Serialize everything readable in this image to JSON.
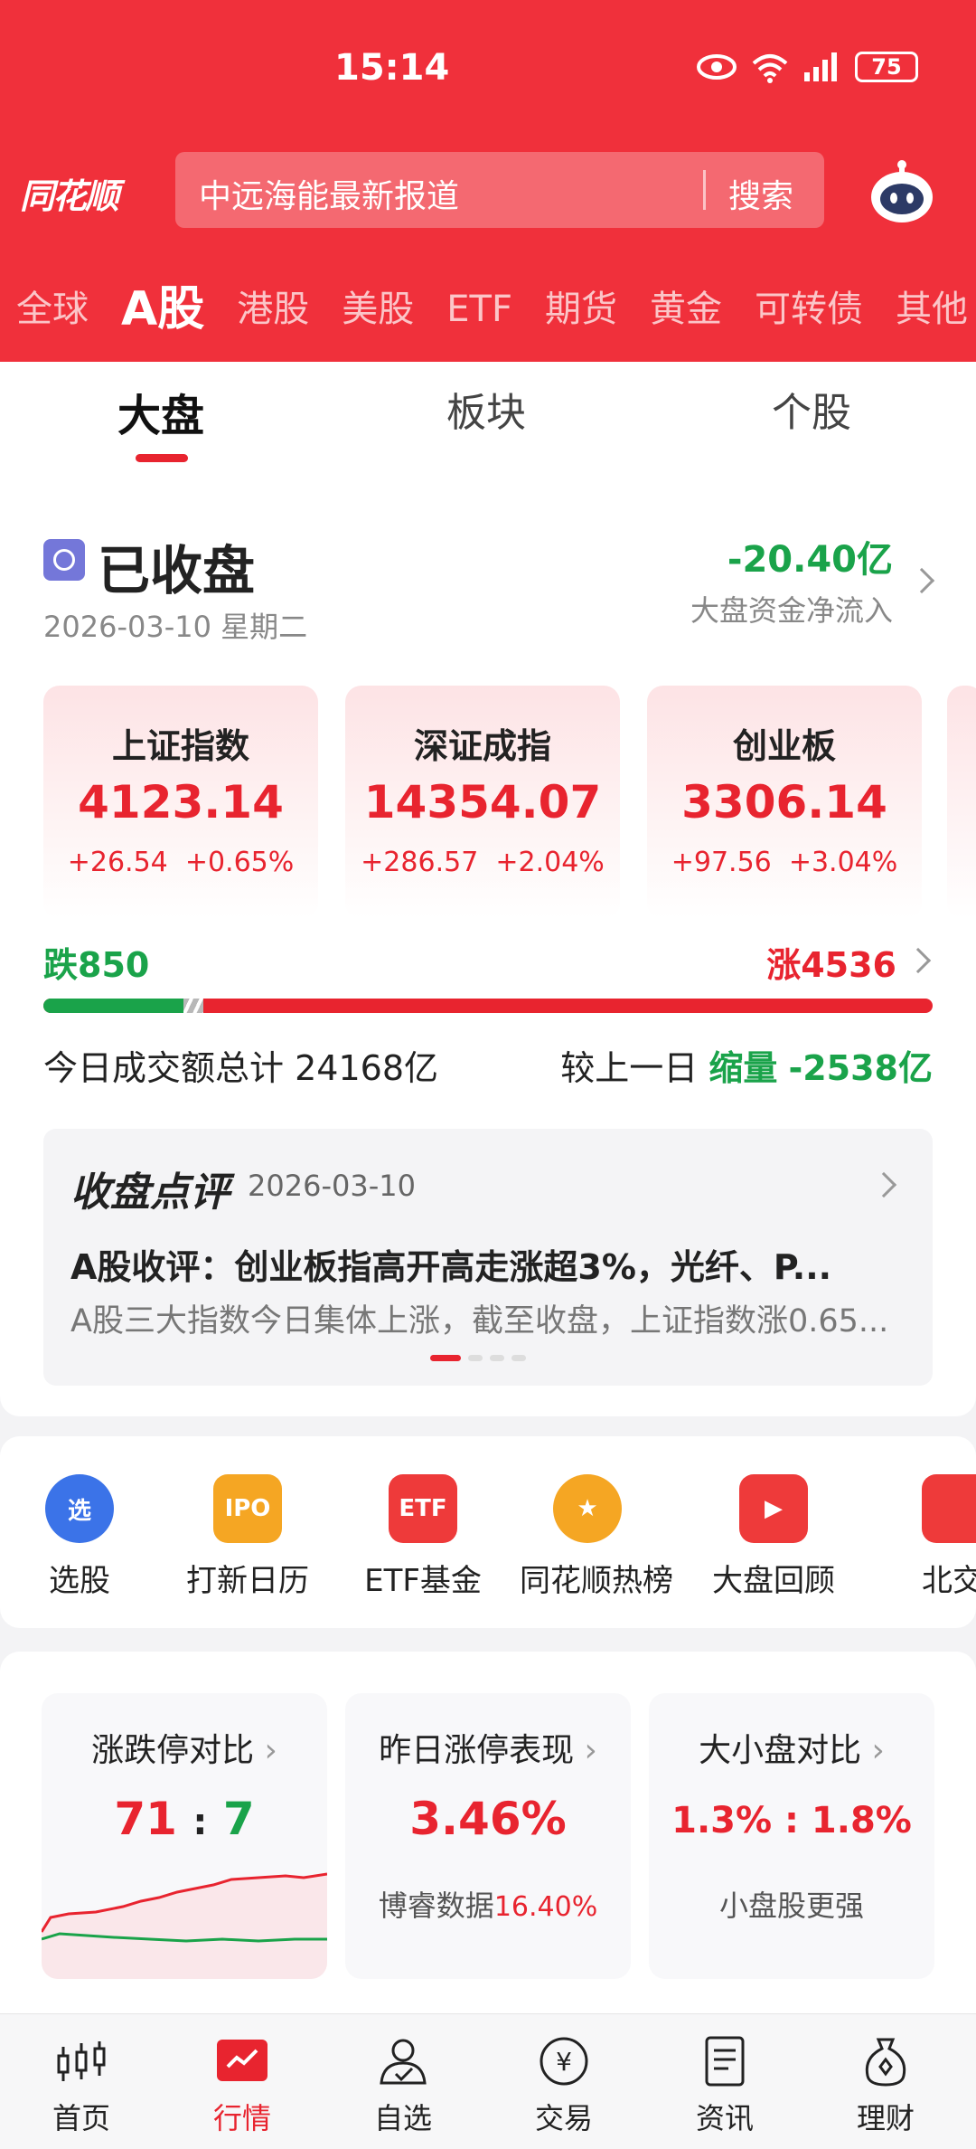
{
  "status_bar": {
    "time": "15:14",
    "signal_label": "4G",
    "wifi_label": "6",
    "battery": "75"
  },
  "header": {
    "logo_text": "同花顺",
    "search_placeholder": "中远海能最新报道",
    "search_button": "搜索",
    "market_tabs": [
      "全球",
      "A股",
      "港股",
      "美股",
      "ETF",
      "期货",
      "黄金",
      "可转债",
      "其他"
    ],
    "active_market_tab": "A股"
  },
  "sub_tabs": [
    "大盘",
    "板块",
    "个股"
  ],
  "active_sub_tab": "大盘",
  "market_status": {
    "title": "已收盘",
    "date": "2026-03-10 星期二",
    "net_flow_value": "-20.40亿",
    "net_flow_label": "大盘资金净流入"
  },
  "indices": [
    {
      "name": "上证指数",
      "value": "4123.14",
      "change": "+26.54",
      "change_pct": "+0.65%"
    },
    {
      "name": "深证成指",
      "value": "14354.07",
      "change": "+286.57",
      "change_pct": "+2.04%"
    },
    {
      "name": "创业板",
      "value": "3306.14",
      "change": "+97.56",
      "change_pct": "+3.04%"
    }
  ],
  "breadth": {
    "down_label": "跌850",
    "up_label": "涨4536",
    "down": 850,
    "up": 4536
  },
  "turnover": {
    "total_label": "今日成交额总计",
    "total_value": "24168亿",
    "compare_label": "较上一日",
    "compare_state": "缩量",
    "compare_value": "-2538亿"
  },
  "closing_review": {
    "title": "收盘点评",
    "date": "2026-03-10",
    "headline": "A股收评：创业板指高开高走涨超3%，光纤、P...",
    "summary": "A股三大指数今日集体上涨，截至收盘，上证指数涨0.65..."
  },
  "tools": [
    {
      "label": "选股",
      "icon": "select-stock-icon",
      "glyph": "选",
      "color": "#3b73e8"
    },
    {
      "label": "打新日历",
      "icon": "ipo-calendar-icon",
      "glyph": "IPO",
      "color": "#f5a623"
    },
    {
      "label": "ETF基金",
      "icon": "etf-fund-icon",
      "glyph": "ETF",
      "color": "#ee3a3a"
    },
    {
      "label": "同花顺热榜",
      "icon": "hot-list-icon",
      "glyph": "★",
      "color": "#f5a623"
    },
    {
      "label": "大盘回顾",
      "icon": "market-review-icon",
      "glyph": "▶",
      "color": "#ee3a3a"
    },
    {
      "label": "北交",
      "icon": "bse-icon",
      "glyph": "",
      "color": "#ee3a3a"
    }
  ],
  "stats": [
    {
      "title": "涨跌停对比",
      "value_left": "71",
      "sep": ":",
      "value_right": "7"
    },
    {
      "title": "昨日涨停表现",
      "value": "3.46%",
      "sub_label": "博睿数据",
      "sub_value": "16.40%"
    },
    {
      "title": "大小盘对比",
      "value": "1.3% : 1.8%",
      "sub": "小盘股更强"
    }
  ],
  "bottom_nav": [
    {
      "label": "首页",
      "icon": "home-icon"
    },
    {
      "label": "行情",
      "icon": "market-icon"
    },
    {
      "label": "自选",
      "icon": "watchlist-icon"
    },
    {
      "label": "交易",
      "icon": "trade-icon"
    },
    {
      "label": "资讯",
      "icon": "news-icon"
    },
    {
      "label": "理财",
      "icon": "wealth-icon"
    }
  ],
  "active_nav": "行情",
  "colors": {
    "brand_red": "#f0303b",
    "rise": "#e8242f",
    "fall": "#1aa34a"
  }
}
